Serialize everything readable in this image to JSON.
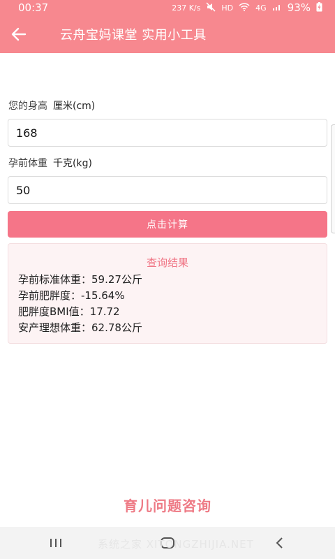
{
  "status": {
    "time": "00:37",
    "speed": "237 K/s",
    "network": "HD",
    "signal": "4G",
    "battery": "93%"
  },
  "appbar": {
    "title": "云舟宝妈课堂 实用小工具"
  },
  "form": {
    "height": {
      "label": "您的身高",
      "unit": "厘米(cm)",
      "value": "168"
    },
    "weight": {
      "label": "孕前体重",
      "unit": "千克(kg)",
      "value": "50"
    },
    "calc_label": "点击计算"
  },
  "result": {
    "title": "查询结果",
    "lines": [
      "孕前标准体重：59.27公斤",
      "孕前肥胖度：-15.64%",
      "肥胖度BMI值：17.72",
      "安产理想体重：62.78公斤"
    ]
  },
  "footer": {
    "consult": "育儿问题咨询",
    "watermark": "系统之家 XITONGZHIJIA.NET"
  },
  "icons": {
    "back": "arrow-left-icon",
    "recents": "recents-icon",
    "home": "home-icon",
    "nav_back": "chevron-left-icon"
  },
  "colors": {
    "primary": "#f7888f",
    "button": "#f57588",
    "accent_text": "#f07484"
  }
}
